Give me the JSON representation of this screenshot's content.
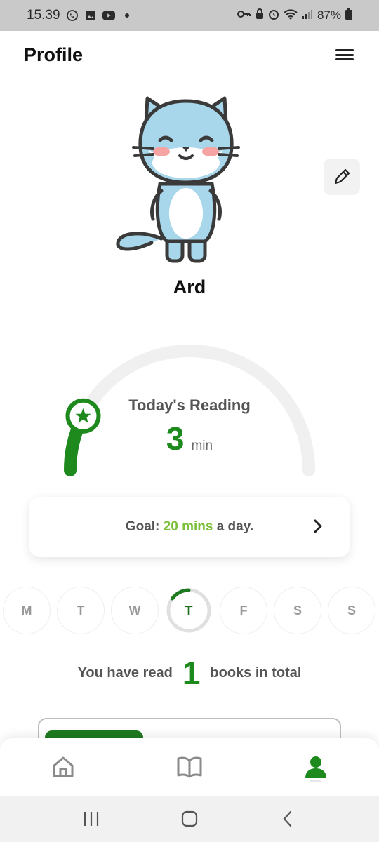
{
  "status_bar": {
    "time": "15.39",
    "battery": "87%"
  },
  "header": {
    "title": "Profile"
  },
  "profile": {
    "name": "Ard"
  },
  "reading": {
    "label": "Today's Reading",
    "value": "3",
    "unit": "min",
    "progress": 0.15
  },
  "goal": {
    "prefix": "Goal:",
    "highlight": "20 mins",
    "suffix": "a day."
  },
  "week": {
    "days": [
      "M",
      "T",
      "W",
      "T",
      "F",
      "S",
      "S"
    ],
    "today_index": 3
  },
  "books": {
    "prefix": "You have read",
    "count": "1",
    "suffix": "books in total"
  },
  "nav": {
    "items": [
      "home",
      "books",
      "profile"
    ],
    "active": "profile"
  },
  "colors": {
    "accent": "#1e8a1e",
    "goal_highlight": "#7bbf3a",
    "text_muted": "#555555"
  }
}
